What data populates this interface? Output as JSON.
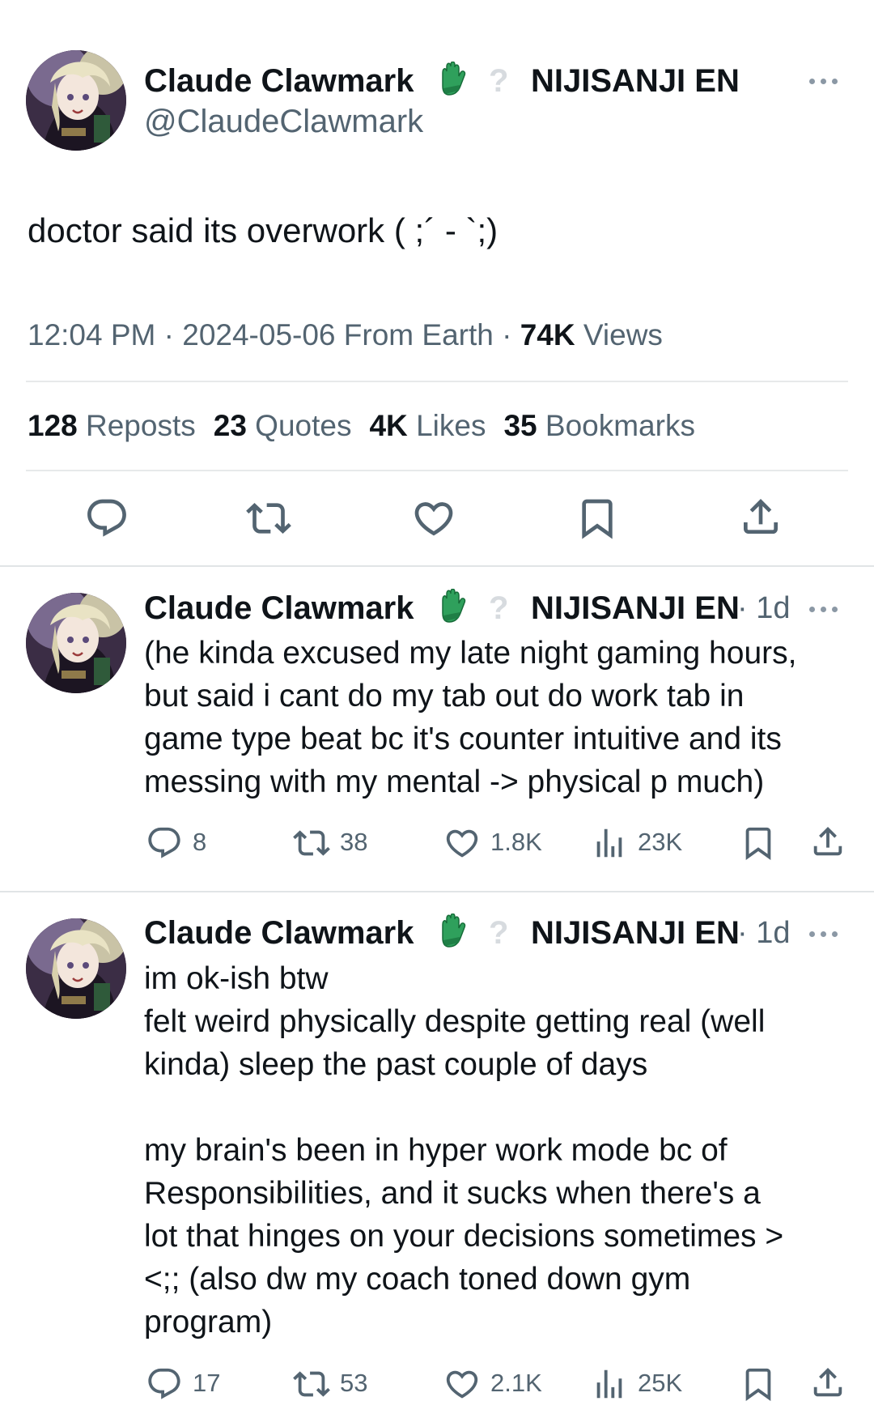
{
  "main_tweet": {
    "author_name": "Claude Clawmark",
    "handle": "@ClaudeClawmark",
    "affiliation": "NIJISANJI EN",
    "text": "doctor said its overwork ( ;´ - `;)",
    "time": "12:04 PM · 2024-05-06 From Earth · ",
    "views_count": "74K",
    "views_label": " Views",
    "reposts_count": "128",
    "reposts_label": " Reposts",
    "quotes_count": "23",
    "quotes_label": " Quotes",
    "likes_count": "4K",
    "likes_label": " Likes",
    "bookmarks_count": "35",
    "bookmarks_label": " Bookmarks"
  },
  "replies": [
    {
      "author_name": "Claude Clawmark",
      "affiliation": "NIJISANJI EN",
      "time": "· 1d",
      "text": "(he kinda excused my late night gaming hours,\nbut said i cant do my tab out do work tab in\ngame type beat bc it's counter intuitive and its\nmessing with my mental -> physical p much)",
      "replies": "8",
      "reposts": "38",
      "likes": "1.8K",
      "views": "23K"
    },
    {
      "author_name": "Claude Clawmark",
      "affiliation": "NIJISANJI EN",
      "time": "· 1d",
      "text": "im ok-ish btw\nfelt weird physically despite getting real (well\nkinda) sleep the past couple of days\n\nmy brain's been in hyper work mode bc of\nResponsibilities, and it sucks when there's a\nlot that hinges on your decisions sometimes >\n<;; (also dw my coach toned down gym\nprogram)",
      "replies": "17",
      "reposts": "53",
      "likes": "2.1K",
      "views": "25K"
    }
  ],
  "colors": {
    "text": "#0f1419",
    "secondary": "#536471",
    "divider": "#e7e9ea",
    "glove": "#2e9e5b"
  },
  "icons": [
    "avatar",
    "green-glove-icon",
    "question-mark-icon",
    "more-icon",
    "reply-icon",
    "repost-icon",
    "like-icon",
    "views-icon",
    "bookmark-icon",
    "share-icon"
  ]
}
